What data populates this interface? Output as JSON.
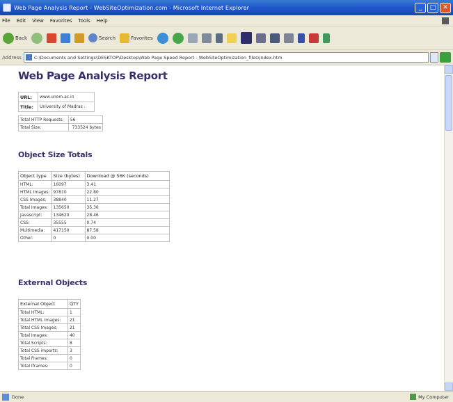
{
  "window": {
    "title": "Web Page Analysis Report - WebSiteOptimization.com - Microsoft Internet Explorer",
    "minimize": "_",
    "maximize": "□",
    "close": "✕"
  },
  "menu": [
    "File",
    "Edit",
    "View",
    "Favorites",
    "Tools",
    "Help"
  ],
  "toolbar": {
    "back_label": "Back",
    "search_label": "Search",
    "favorites_label": "Favorites"
  },
  "address": {
    "label": "Address",
    "value": "C:\\Documents and Settings\\DESKTOP\\Desktop\\Web Page Speed Report - WebSiteOptimization_files\\index.htm"
  },
  "report": {
    "title": "Web Page Analysis Report",
    "info": [
      {
        "label": "URL:",
        "value": "www.unom.ac.in"
      },
      {
        "label": "Title:",
        "value": "University of Madras :"
      }
    ],
    "summary": [
      {
        "label": "Total HTTP Requests:",
        "value": "56"
      },
      {
        "label": "Total Size:",
        "value": "733524 bytes"
      }
    ],
    "size_section_title": "Object Size Totals",
    "size_headers": [
      "Object type",
      "Size (bytes)",
      "Download @ 56K (seconds)"
    ],
    "size_rows": [
      [
        "HTML:",
        "16097",
        "3.41"
      ],
      [
        "HTML Images:",
        "97810",
        "22.80"
      ],
      [
        "CSS Images:",
        "38840",
        "11.27"
      ],
      [
        "Total Images:",
        "135650",
        "35.36"
      ],
      [
        "Javascript:",
        "134620",
        "28.46"
      ],
      [
        "CSS:",
        "35555",
        "0.74"
      ],
      [
        "Multimedia:",
        "417150",
        "87.58"
      ],
      [
        "Other:",
        "0",
        "0.00"
      ]
    ],
    "external_section_title": "External Objects",
    "external_headers": [
      "External Object",
      "QTY"
    ],
    "external_rows": [
      [
        "Total HTML:",
        "1"
      ],
      [
        "Total HTML Images:",
        "21"
      ],
      [
        "Total CSS Images:",
        "21"
      ],
      [
        "Total Images:",
        "40"
      ],
      [
        "Total Scripts:",
        "8"
      ],
      [
        "Total CSS imports:",
        "3"
      ],
      [
        "Total Frames:",
        "0"
      ],
      [
        "Total Iframes:",
        "0"
      ]
    ]
  },
  "status": {
    "left": "Done",
    "zone": "My Computer"
  }
}
